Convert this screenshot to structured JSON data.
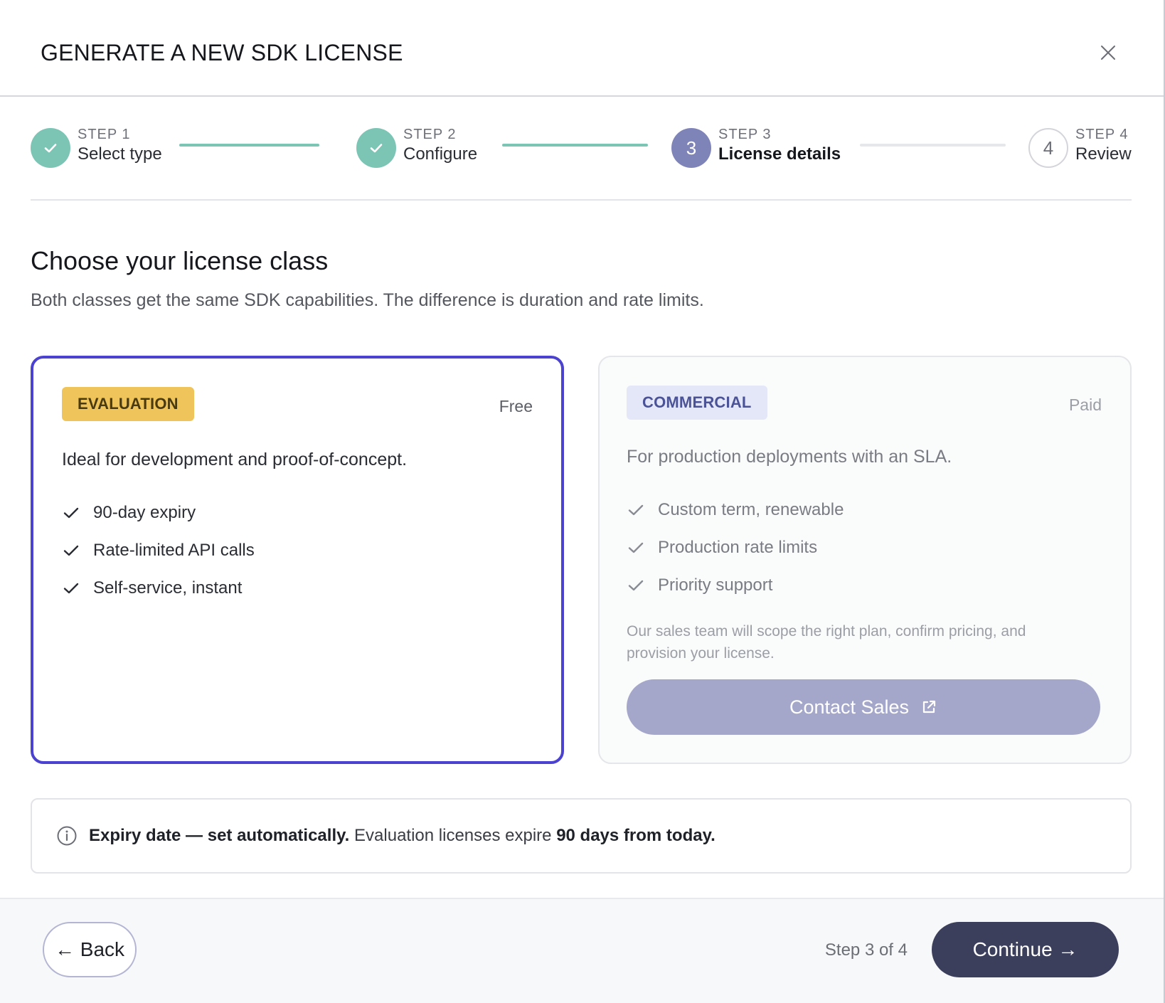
{
  "header": {
    "title": "GENERATE A NEW SDK LICENSE",
    "close_icon": "close-icon"
  },
  "stepper": {
    "steps": [
      {
        "number": "STEP 1",
        "label": "Select type",
        "state": "done"
      },
      {
        "number": "STEP 2",
        "label": "Configure",
        "state": "done"
      },
      {
        "number": "STEP 3",
        "label": "License details",
        "state": "active",
        "circle": "3"
      },
      {
        "number": "STEP 4",
        "label": "Review",
        "state": "todo",
        "circle": "4"
      }
    ]
  },
  "section": {
    "title": "Choose your license class",
    "subtitle": "Both classes get the same SDK capabilities. The difference is duration and rate limits."
  },
  "cards": {
    "evaluation": {
      "badge": "EVALUATION",
      "price": "Free",
      "description": "Ideal for development and proof-of-concept.",
      "features": [
        "90-day expiry",
        "Rate-limited API calls",
        "Self-service, instant"
      ],
      "selected": true
    },
    "commercial": {
      "badge": "COMMERCIAL",
      "price": "Paid",
      "description": "For production deployments with an SLA.",
      "features": [
        "Custom term, renewable",
        "Production rate limits",
        "Priority support"
      ],
      "note": "Our sales team will scope the right plan, confirm pricing, and provision your license.",
      "button_label": "Contact Sales"
    }
  },
  "info": {
    "lead": "Expiry date — set automatically.",
    "text": " Evaluation licenses expire ",
    "emphasis": "90 days from today."
  },
  "footer": {
    "back_label": "← Back",
    "step_count": "Step 3 of 4",
    "continue_label": "Continue →"
  },
  "colors": {
    "accent": "#4b43cf",
    "done": "#7cc4b4",
    "active_step": "#7f84b8",
    "primary_button": "#3c3f5c",
    "evaluation_badge": "#efc45a",
    "commercial_badge": "#e3e7f8"
  }
}
